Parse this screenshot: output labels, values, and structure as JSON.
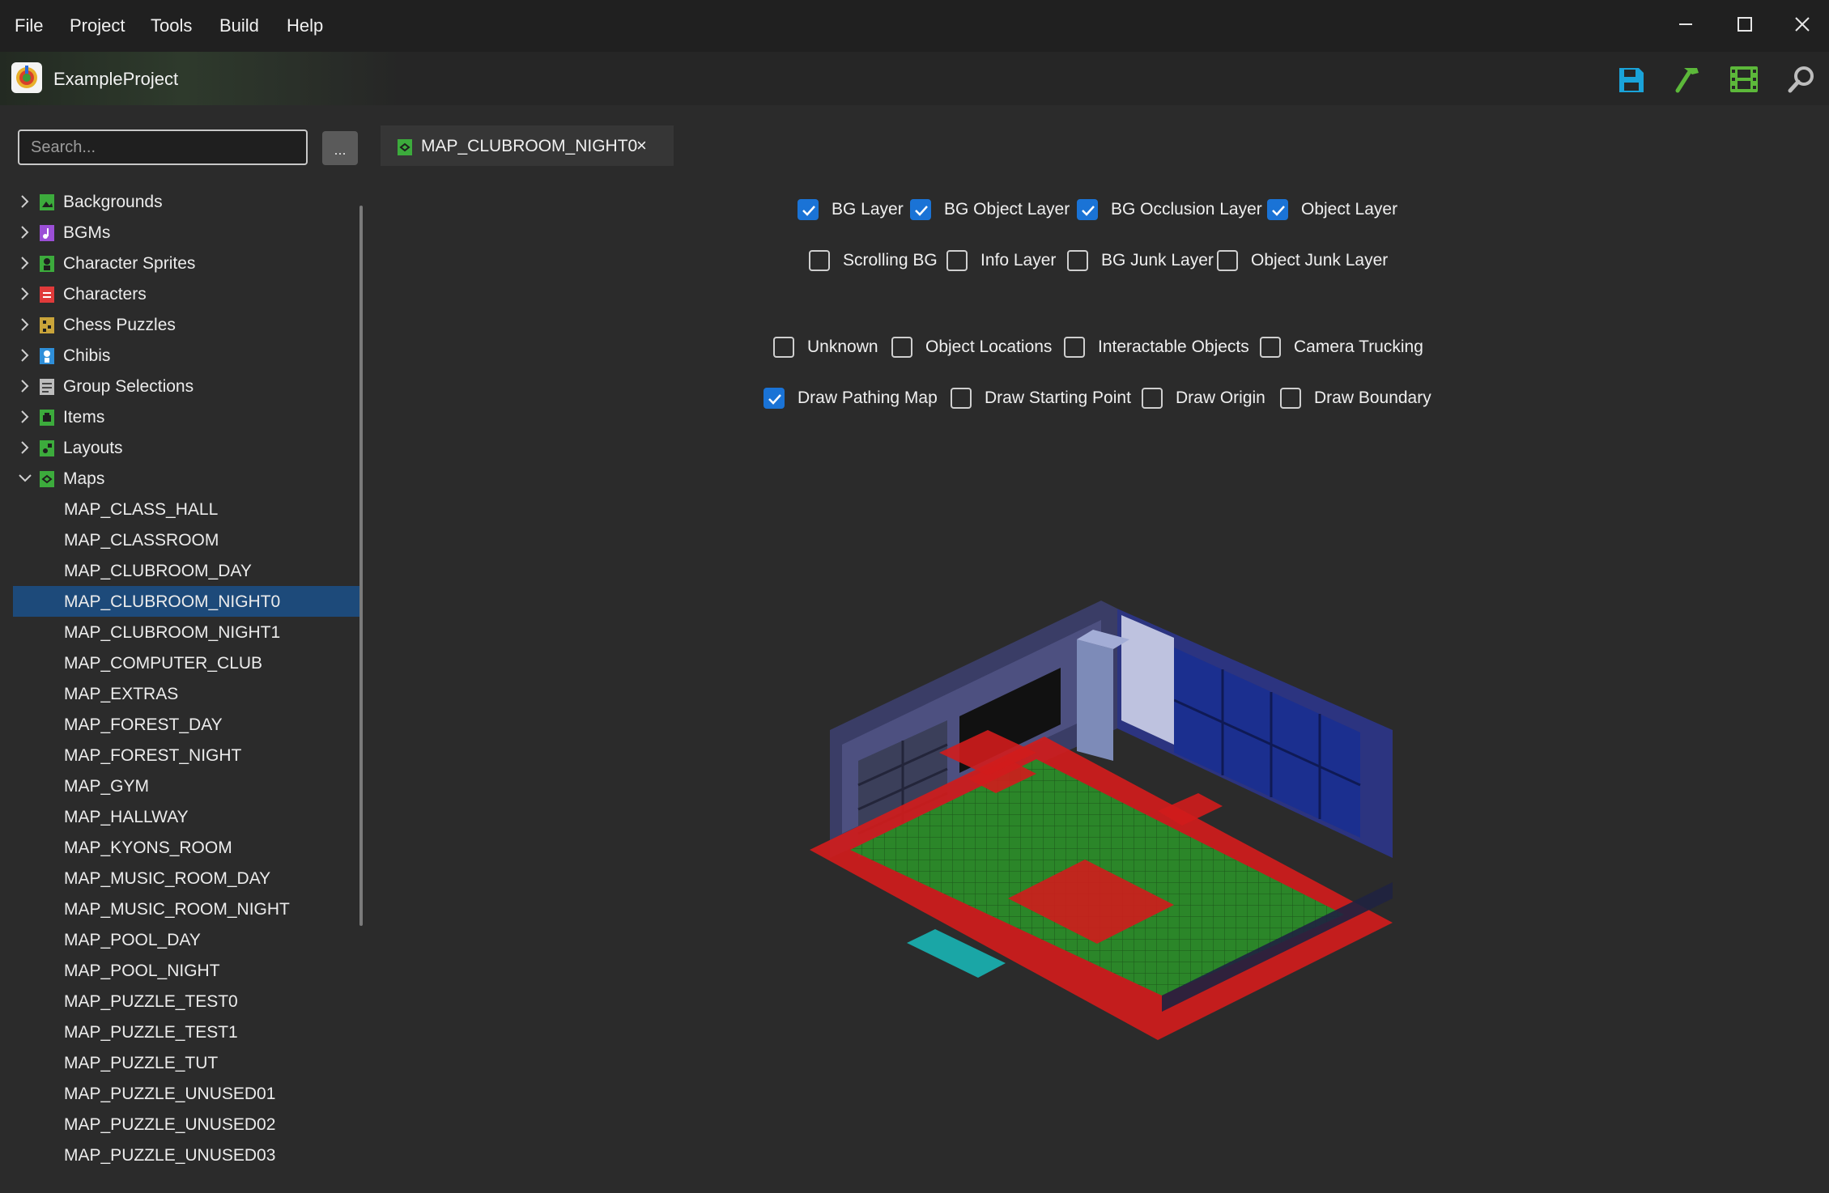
{
  "menu": {
    "items": [
      "File",
      "Project",
      "Tools",
      "Build",
      "Help"
    ]
  },
  "window_controls": {
    "minimize_icon": "minimize-icon",
    "maximize_icon": "maximize-icon",
    "close_icon": "close-icon"
  },
  "header": {
    "project_name": "ExampleProject",
    "tools": [
      {
        "name": "save-icon",
        "color": "#1aa3d9"
      },
      {
        "name": "hammer-icon",
        "color": "#5cb83a"
      },
      {
        "name": "film-icon",
        "color": "#5cb83a"
      },
      {
        "name": "search-icon",
        "color": "#bdbdbd"
      }
    ]
  },
  "sidebar": {
    "search": {
      "placeholder": "Search...",
      "value": ""
    },
    "options_label": "...",
    "categories": [
      {
        "label": "Backgrounds",
        "icon": "backgrounds-icon",
        "color": "#3cab3c",
        "expanded": false
      },
      {
        "label": "BGMs",
        "icon": "music-icon",
        "color": "#9b4fd6",
        "expanded": false
      },
      {
        "label": "Character Sprites",
        "icon": "character-sprites-icon",
        "color": "#3cab3c",
        "expanded": false
      },
      {
        "label": "Characters",
        "icon": "characters-icon",
        "color": "#e03a3a",
        "expanded": false
      },
      {
        "label": "Chess Puzzles",
        "icon": "chess-puzzles-icon",
        "color": "#c9a43a",
        "expanded": false
      },
      {
        "label": "Chibis",
        "icon": "chibis-icon",
        "color": "#2f8fd9",
        "expanded": false
      },
      {
        "label": "Group Selections",
        "icon": "group-selections-icon",
        "color": "#bdbdbd",
        "expanded": false
      },
      {
        "label": "Items",
        "icon": "items-icon",
        "color": "#3cab3c",
        "expanded": false
      },
      {
        "label": "Layouts",
        "icon": "layouts-icon",
        "color": "#3cab3c",
        "expanded": false
      },
      {
        "label": "Maps",
        "icon": "maps-icon",
        "color": "#3cab3c",
        "expanded": true
      }
    ],
    "maps": [
      "MAP_CLASS_HALL",
      "MAP_CLASSROOM",
      "MAP_CLUBROOM_DAY",
      "MAP_CLUBROOM_NIGHT0",
      "MAP_CLUBROOM_NIGHT1",
      "MAP_COMPUTER_CLUB",
      "MAP_EXTRAS",
      "MAP_FOREST_DAY",
      "MAP_FOREST_NIGHT",
      "MAP_GYM",
      "MAP_HALLWAY",
      "MAP_KYONS_ROOM",
      "MAP_MUSIC_ROOM_DAY",
      "MAP_MUSIC_ROOM_NIGHT",
      "MAP_POOL_DAY",
      "MAP_POOL_NIGHT",
      "MAP_PUZZLE_TEST0",
      "MAP_PUZZLE_TEST1",
      "MAP_PUZZLE_TUT",
      "MAP_PUZZLE_UNUSED01",
      "MAP_PUZZLE_UNUSED02",
      "MAP_PUZZLE_UNUSED03"
    ],
    "selected_map": "MAP_CLUBROOM_NIGHT0"
  },
  "editor": {
    "tab": {
      "label": "MAP_CLUBROOM_NIGHT0",
      "close": "×"
    },
    "layer_options": {
      "row1": [
        {
          "label": "BG Layer",
          "checked": true
        },
        {
          "label": "BG Object Layer",
          "checked": true
        },
        {
          "label": "BG Occlusion Layer",
          "checked": true
        },
        {
          "label": "Object Layer",
          "checked": true
        }
      ],
      "row2": [
        {
          "label": "Scrolling BG",
          "checked": false
        },
        {
          "label": "Info Layer",
          "checked": false
        },
        {
          "label": "BG Junk Layer",
          "checked": false
        },
        {
          "label": "Object Junk Layer",
          "checked": false
        }
      ]
    },
    "draw_options": {
      "row1": [
        {
          "label": "Unknown",
          "checked": false
        },
        {
          "label": "Object Locations",
          "checked": false
        },
        {
          "label": "Interactable Objects",
          "checked": false
        },
        {
          "label": "Camera Trucking",
          "checked": false
        }
      ],
      "row2": [
        {
          "label": "Draw Pathing Map",
          "checked": true
        },
        {
          "label": "Draw Starting Point",
          "checked": false
        },
        {
          "label": "Draw Origin",
          "checked": false
        },
        {
          "label": "Draw Boundary",
          "checked": false
        }
      ]
    },
    "map_preview": {
      "walkable_color": "#1e8f2a",
      "blocked_color": "#d01c1c",
      "accent_color": "#1aa6a6"
    }
  }
}
